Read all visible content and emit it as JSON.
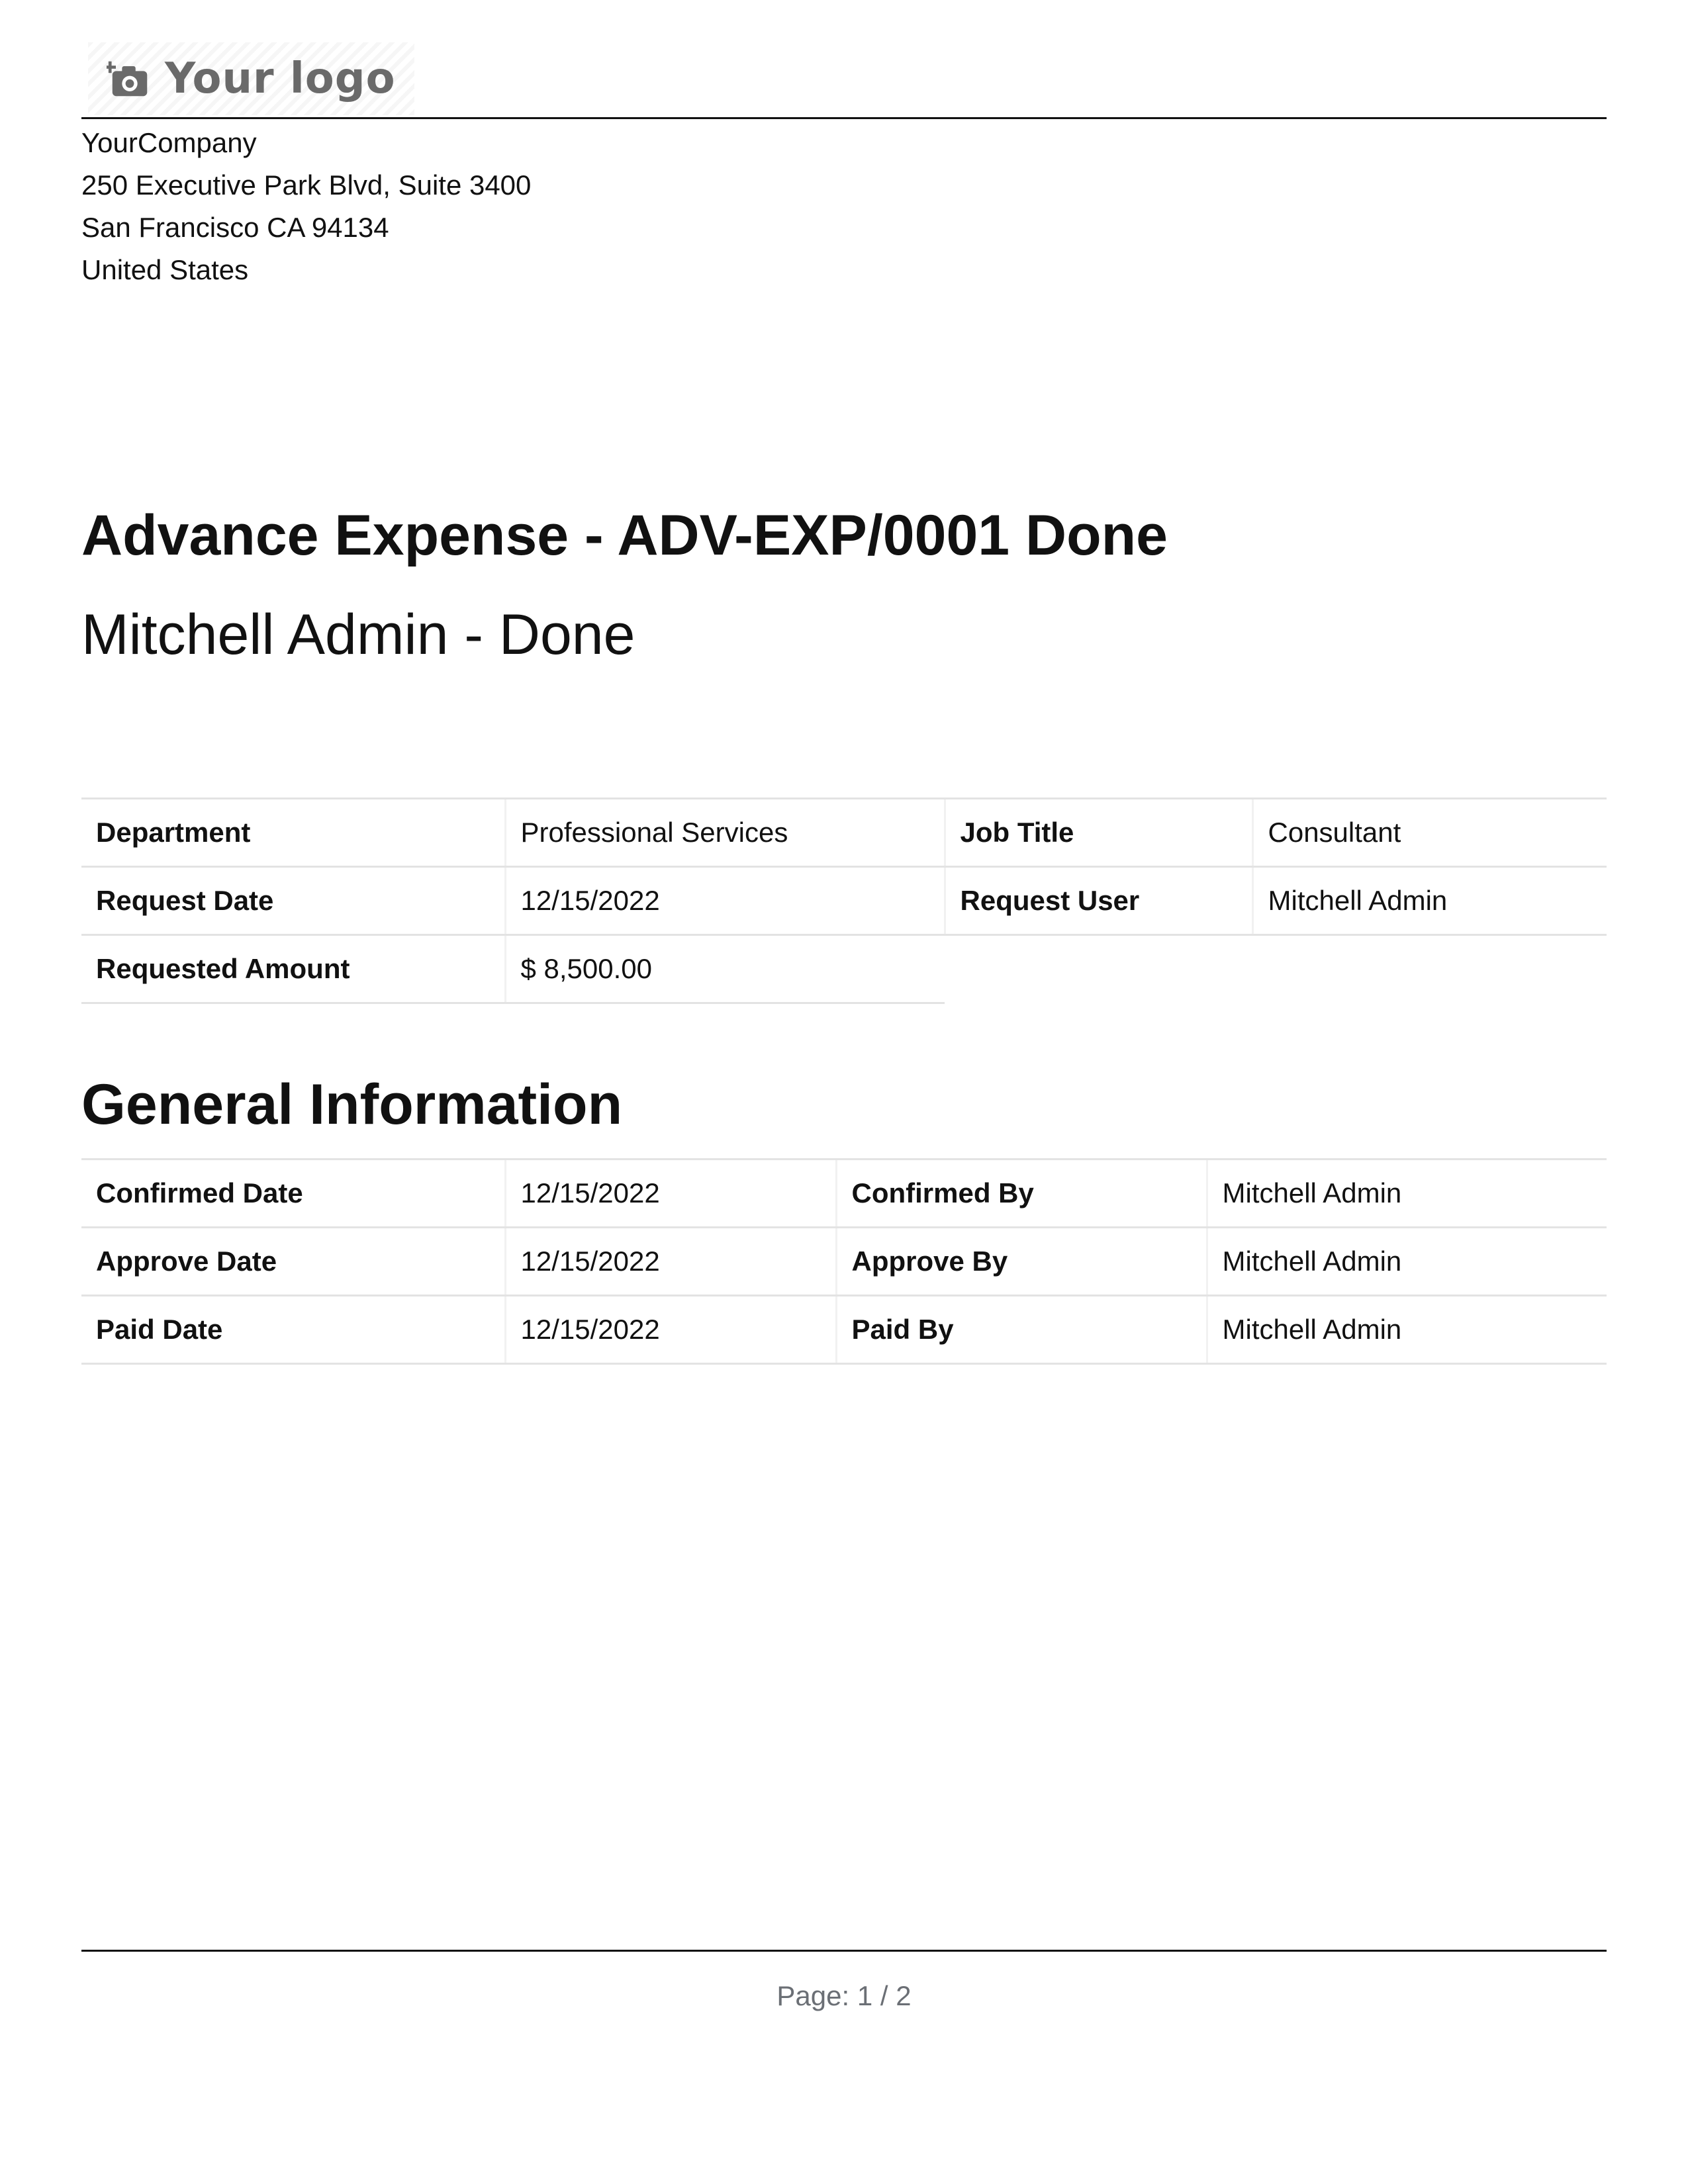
{
  "header": {
    "logo_text": "Your logo",
    "logo_icon": "camera-add-icon"
  },
  "company": {
    "name": "YourCompany",
    "street": "250 Executive Park Blvd, Suite 3400",
    "city_line": "San Francisco CA 94134",
    "country": "United States"
  },
  "document": {
    "title": "Advance Expense - ADV-EXP/0001 Done",
    "subtitle": "Mitchell Admin - Done"
  },
  "details": {
    "department_label": "Department",
    "department_value": "Professional Services",
    "job_title_label": "Job Title",
    "job_title_value": "Consultant",
    "request_date_label": "Request Date",
    "request_date_value": "12/15/2022",
    "request_user_label": "Request User",
    "request_user_value": "Mitchell Admin",
    "requested_amount_label": "Requested Amount",
    "requested_amount_value": "$ 8,500.00"
  },
  "general_information": {
    "heading": "General Information",
    "rows": [
      {
        "date_label": "Confirmed Date",
        "date_value": "12/15/2022",
        "by_label": "Confirmed By",
        "by_value": "Mitchell Admin"
      },
      {
        "date_label": "Approve Date",
        "date_value": "12/15/2022",
        "by_label": "Approve By",
        "by_value": "Mitchell Admin"
      },
      {
        "date_label": "Paid Date",
        "date_value": "12/15/2022",
        "by_label": "Paid By",
        "by_value": "Mitchell Admin"
      }
    ]
  },
  "footer": {
    "page_text": "Page: 1 / 2"
  },
  "colors": {
    "text": "#111111",
    "rule": "#111111",
    "table_border": "#e3e3e3",
    "footer_text": "#6b6f75",
    "logo_text": "#6a6a6a"
  }
}
